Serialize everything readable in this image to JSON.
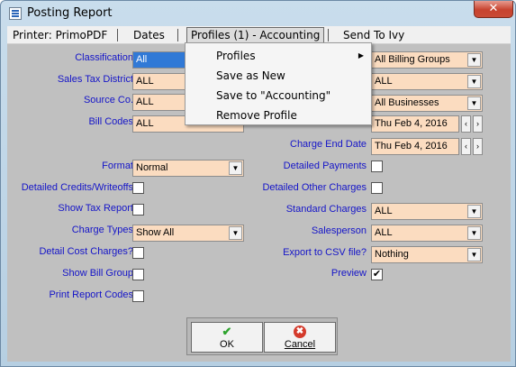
{
  "window": {
    "title": "Posting Report",
    "close_glyph": "✕"
  },
  "menubar": {
    "printer": "Printer: PrimoPDF",
    "dates": "Dates",
    "profiles": "Profiles (1) - Accounting",
    "send": "Send To Ivy"
  },
  "popup": {
    "items": [
      "Profiles",
      "Save as New",
      "Save to \"Accounting\"",
      "Remove Profile"
    ],
    "submenu_arrow": "▶"
  },
  "left": {
    "classification": {
      "label": "Classification",
      "value": "All"
    },
    "sales_tax_district": {
      "label": "Sales Tax District",
      "value": "ALL"
    },
    "source_co": {
      "label": "Source Co.",
      "value": "ALL"
    },
    "bill_codes": {
      "label": "Bill Codes",
      "value": "ALL"
    },
    "format": {
      "label": "Format",
      "value": "Normal"
    },
    "detailed_credits": {
      "label": "Detailed Credits/Writeoffs",
      "checked": false
    },
    "show_tax_report": {
      "label": "Show Tax Report",
      "checked": false
    },
    "charge_types": {
      "label": "Charge Types",
      "value": "Show All"
    },
    "detail_cost_charges": {
      "label": "Detail Cost Charges?",
      "checked": false
    },
    "show_bill_group": {
      "label": "Show Bill Group",
      "checked": false
    },
    "print_report_codes": {
      "label": "Print Report Codes",
      "checked": false
    }
  },
  "right": {
    "billing_groups": {
      "value": "All Billing Groups"
    },
    "all2": {
      "value": "ALL"
    },
    "businesses": {
      "value": "All Businesses"
    },
    "start_date": {
      "value": "Thu Feb  4, 2016"
    },
    "charge_end_date": {
      "label": "Charge End Date",
      "value": "Thu Feb  4, 2016"
    },
    "detailed_payments": {
      "label": "Detailed Payments",
      "checked": false
    },
    "detailed_other_charges": {
      "label": "Detailed Other Charges",
      "checked": false
    },
    "standard_charges": {
      "label": "Standard Charges",
      "value": "ALL"
    },
    "salesperson": {
      "label": "Salesperson",
      "value": "ALL"
    },
    "export_csv": {
      "label": "Export to CSV file?",
      "value": "Nothing"
    },
    "preview": {
      "label": "Preview",
      "checked": true
    }
  },
  "glyphs": {
    "dropdown": "▼",
    "spin_left": "‹",
    "spin_right": "›",
    "check": "✔",
    "ok": "✔",
    "cancel": "✖"
  },
  "buttons": {
    "ok": "OK",
    "cancel": "Cancel"
  }
}
